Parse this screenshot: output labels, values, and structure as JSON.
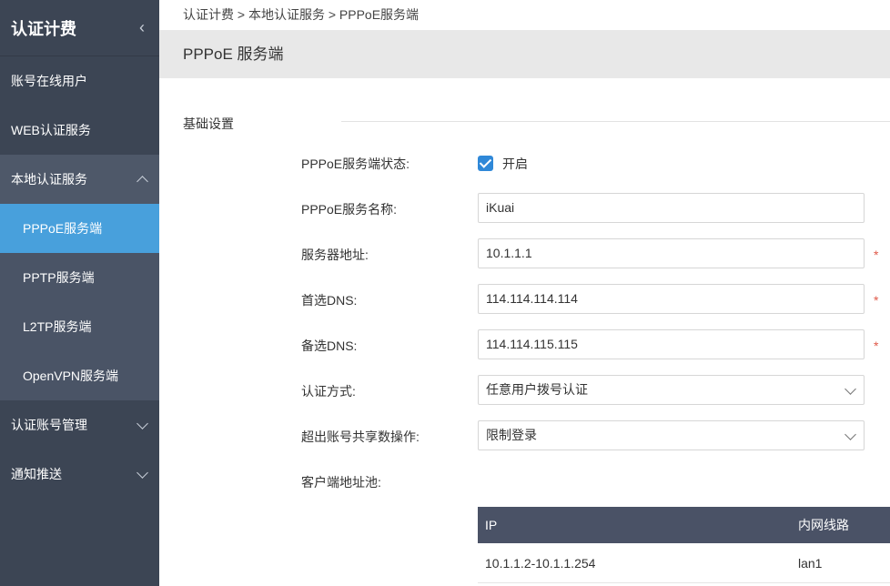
{
  "sidebar": {
    "title": "认证计费",
    "items": [
      {
        "label": "账号在线用户"
      },
      {
        "label": "WEB认证服务"
      },
      {
        "label": "本地认证服务"
      },
      {
        "label": "认证账号管理"
      },
      {
        "label": "通知推送"
      }
    ],
    "subitems": [
      {
        "label": "PPPoE服务端"
      },
      {
        "label": "PPTP服务端"
      },
      {
        "label": "L2TP服务端"
      },
      {
        "label": "OpenVPN服务端"
      }
    ]
  },
  "breadcrumb": "认证计费 > 本地认证服务 > PPPoE服务端",
  "page_title": "PPPoE 服务端",
  "section_title": "基础设置",
  "form": {
    "status_label": "PPPoE服务端状态:",
    "status_checked": true,
    "status_text": "开启",
    "name_label": "PPPoE服务名称:",
    "name_value": "iKuai",
    "server_label": "服务器地址:",
    "server_value": "10.1.1.1",
    "dns1_label": "首选DNS:",
    "dns1_value": "114.114.114.114",
    "dns2_label": "备选DNS:",
    "dns2_value": "114.114.115.115",
    "auth_label": "认证方式:",
    "auth_value": "任意用户拨号认证",
    "exceed_label": "超出账号共享数操作:",
    "exceed_value": "限制登录",
    "pool_label": "客户端地址池:",
    "required_mark": "*"
  },
  "pool_table": {
    "headers": {
      "ip": "IP",
      "line": "内网线路"
    },
    "rows": [
      {
        "ip": "10.1.1.2-10.1.1.254",
        "line": "lan1"
      }
    ]
  },
  "colors": {
    "sidebar_bg": "#3c4554",
    "active_bg": "#48a0dc",
    "table_header_bg": "#4a5266",
    "required": "#e05a4a"
  }
}
